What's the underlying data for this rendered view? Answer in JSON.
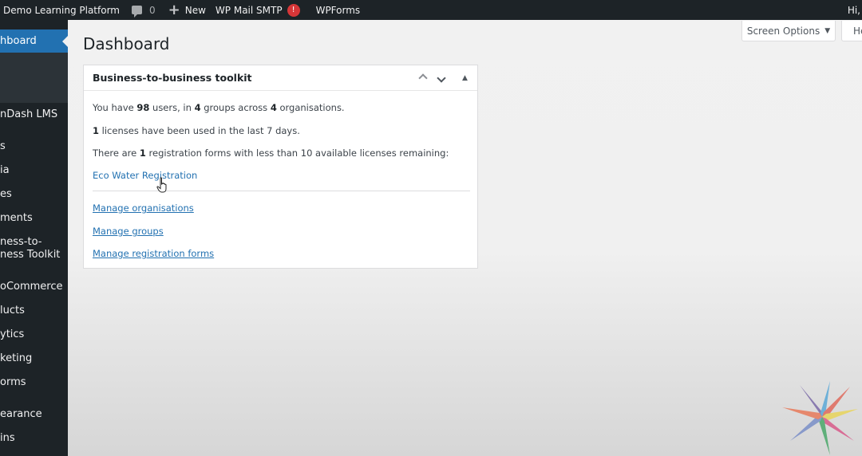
{
  "adminbar": {
    "site_name": "Demo Learning Platform",
    "comments_count": "0",
    "new_label": "New",
    "smtp_label": "WP Mail SMTP",
    "smtp_badge": "!",
    "wpforms_label": "WPForms",
    "greeting": "Hi,"
  },
  "sidebar": {
    "items": [
      {
        "label": "Dashboard",
        "visible_text": "hboard"
      },
      {
        "label": "LearnDash LMS",
        "visible_text": "nDash LMS"
      },
      {
        "label": "Posts",
        "visible_text": "s"
      },
      {
        "label": "Media",
        "visible_text": "ia"
      },
      {
        "label": "Pages",
        "visible_text": "es"
      },
      {
        "label": "Comments",
        "visible_text": "ments"
      },
      {
        "label": "Business-to-Business Toolkit",
        "visible_text": "ness-to-\nness Toolkit",
        "line1": "ness-to-",
        "line2": "ness Toolkit"
      },
      {
        "label": "WooCommerce",
        "visible_text": "oCommerce"
      },
      {
        "label": "Products",
        "visible_text": "lucts"
      },
      {
        "label": "Analytics",
        "visible_text": "ytics"
      },
      {
        "label": "Marketing",
        "visible_text": "keting"
      },
      {
        "label": "WPForms",
        "visible_text": "orms"
      },
      {
        "label": "Appearance",
        "visible_text": "earance"
      },
      {
        "label": "Plugins",
        "visible_text": "ins"
      }
    ]
  },
  "header": {
    "screen_options": "Screen Options",
    "help": "He",
    "page_title": "Dashboard"
  },
  "widget": {
    "title": "Business-to-business toolkit",
    "stats": {
      "users": "98",
      "groups": "4",
      "organisations": "4",
      "licenses_used": "1",
      "forms_low": "1"
    },
    "text": {
      "line1_a": "You have ",
      "line1_b": " users, in ",
      "line1_c": " groups across ",
      "line1_d": " organisations.",
      "line2_b": " licenses have been used in the last 7 days.",
      "line3_a": "There are ",
      "line3_b": " registration forms with less than 10 available licenses remaining:"
    },
    "form_link": "Eco Water Registration",
    "links": [
      "Manage organisations",
      "Manage groups",
      "Manage registration forms"
    ]
  },
  "colors": {
    "admin_bar": "#1d2327",
    "accent": "#2271b1",
    "badge": "#d63638"
  }
}
